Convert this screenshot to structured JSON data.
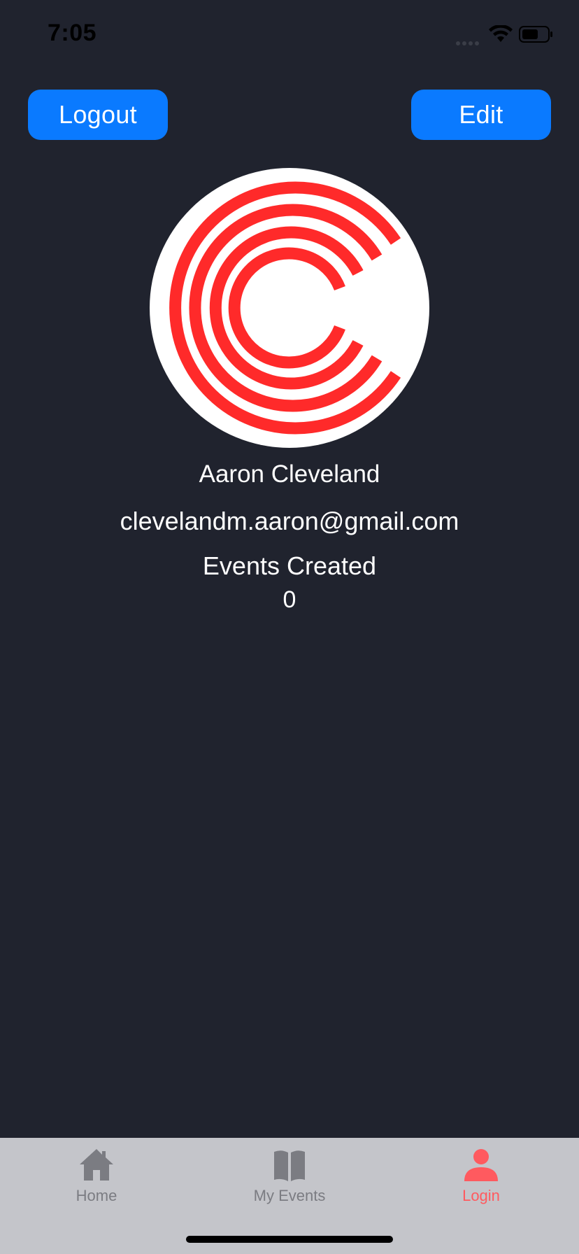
{
  "status_bar": {
    "time": "7:05"
  },
  "header": {
    "logout_label": "Logout",
    "edit_label": "Edit"
  },
  "profile": {
    "avatar_icon": "c-logo-icon",
    "name": "Aaron Cleveland",
    "email": "clevelandm.aaron@gmail.com",
    "events_created_label": "Events Created",
    "events_created_count": "0"
  },
  "tab_bar": {
    "items": [
      {
        "label": "Home",
        "icon": "home-icon",
        "active": false
      },
      {
        "label": "My Events",
        "icon": "book-icon",
        "active": false
      },
      {
        "label": "Login",
        "icon": "user-icon",
        "active": true
      }
    ]
  },
  "colors": {
    "background": "#20232e",
    "accent": "#0a7aff",
    "active_tab": "#ff5a5f",
    "inactive_tab": "#7b7c82",
    "tab_bar_bg": "#c4c5ca",
    "avatar_ring": "#ff2a2a"
  }
}
